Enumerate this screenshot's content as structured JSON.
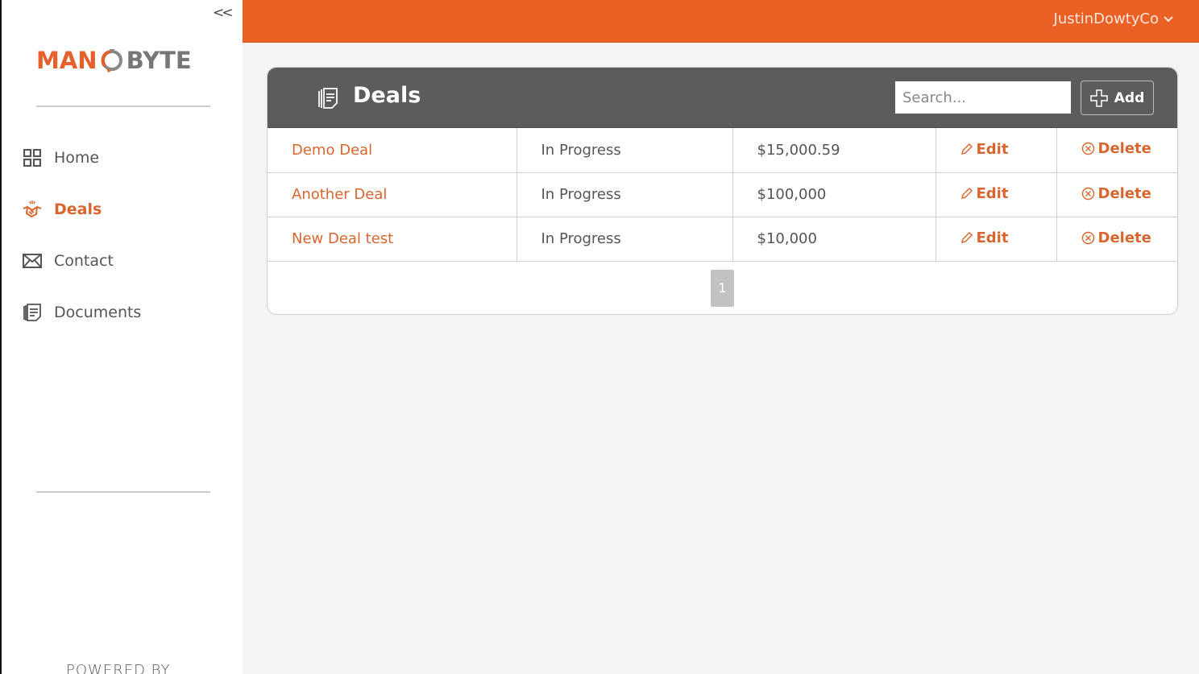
{
  "sidebar": {
    "collapse_label": "<<",
    "logo": {
      "left": "MAN",
      "right": "BYTE"
    },
    "items": [
      {
        "label": "Home",
        "icon": "grid-icon",
        "active": false
      },
      {
        "label": "Deals",
        "icon": "handshake-icon",
        "active": true
      },
      {
        "label": "Contact",
        "icon": "envelope-icon",
        "active": false
      },
      {
        "label": "Documents",
        "icon": "documents-icon",
        "active": false
      }
    ],
    "footer": "POWERED BY"
  },
  "topbar": {
    "user": "JustinDowtyCo",
    "accent_color": "#eb6125"
  },
  "deals": {
    "title": "Deals",
    "search_placeholder": "Search...",
    "add_label": "Add",
    "rows": [
      {
        "name": "Demo Deal",
        "status": "In Progress",
        "amount": "$15,000.59",
        "edit": "Edit",
        "delete": "Delete"
      },
      {
        "name": "Another Deal",
        "status": "In Progress",
        "amount": "$100,000",
        "edit": "Edit",
        "delete": "Delete"
      },
      {
        "name": "New Deal test",
        "status": "In Progress",
        "amount": "$10,000",
        "edit": "Edit",
        "delete": "Delete"
      }
    ],
    "pagination": {
      "current_page": "1"
    }
  }
}
